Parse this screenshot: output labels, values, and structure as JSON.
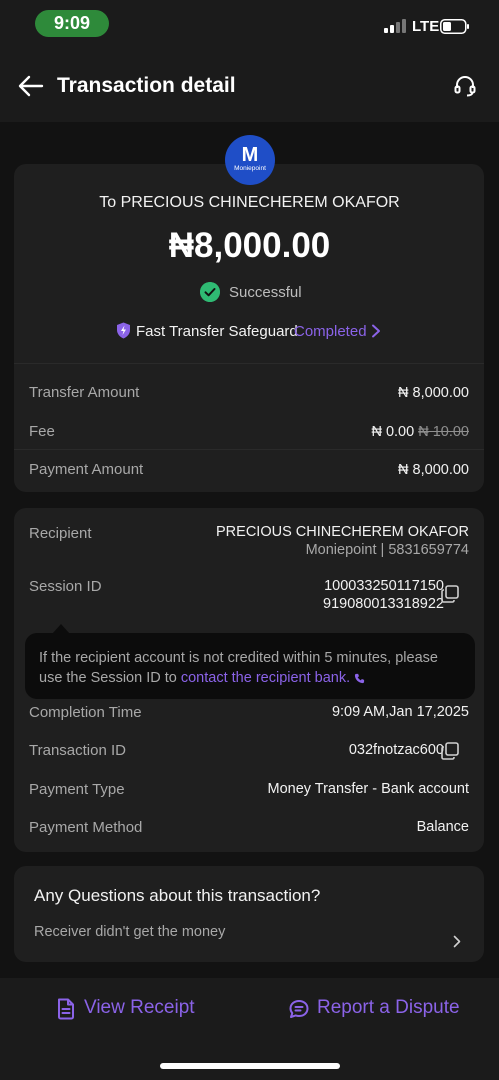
{
  "status_bar": {
    "time": "9:09",
    "network": "LTE"
  },
  "header": {
    "title": "Transaction detail"
  },
  "logo": {
    "letter": "M",
    "brand": "Moniepoint"
  },
  "summary": {
    "recipient_line": "To PRECIOUS CHINECHEREM OKAFOR",
    "amount": "₦8,000.00",
    "status": "Successful",
    "safeguard_label": "Fast Transfer Safeguard",
    "safeguard_status": "Completed"
  },
  "amounts": {
    "transfer_amount_label": "Transfer Amount",
    "transfer_amount_value": "₦ 8,000.00",
    "fee_label": "Fee",
    "fee_value": "₦ 0.00",
    "fee_original": "₦ 10.00",
    "payment_amount_label": "Payment Amount",
    "payment_amount_value": "₦ 8,000.00"
  },
  "details": {
    "recipient_label": "Recipient",
    "recipient_name": "PRECIOUS CHINECHEREM OKAFOR",
    "recipient_bank": "Moniepoint | 5831659774",
    "session_label": "Session ID",
    "session_line1": "100033250117150",
    "session_line2": "919080013318922",
    "completion_label": "Completion Time",
    "completion_value": "9:09 AM,Jan 17,2025",
    "transaction_id_label": "Transaction ID",
    "transaction_id_value": "032fnotzac600",
    "payment_type_label": "Payment Type",
    "payment_type_value": "Money Transfer - Bank account",
    "payment_method_label": "Payment Method",
    "payment_method_value": "Balance"
  },
  "tooltip": {
    "text": "If the recipient account is not credited within 5 minutes, please use the Session ID to ",
    "link": "contact the recipient bank."
  },
  "questions": {
    "title": "Any Questions about this transaction?",
    "item": "Receiver didn't get the money"
  },
  "actions": {
    "view_receipt": "View Receipt",
    "report_dispute": "Report a Dispute"
  },
  "colors": {
    "accent": "#8b63e8",
    "success": "#2fba73",
    "background": "#121212",
    "card": "#1f1f1f",
    "time_pill": "#2e8a3a",
    "logo": "#1f4ec7"
  }
}
